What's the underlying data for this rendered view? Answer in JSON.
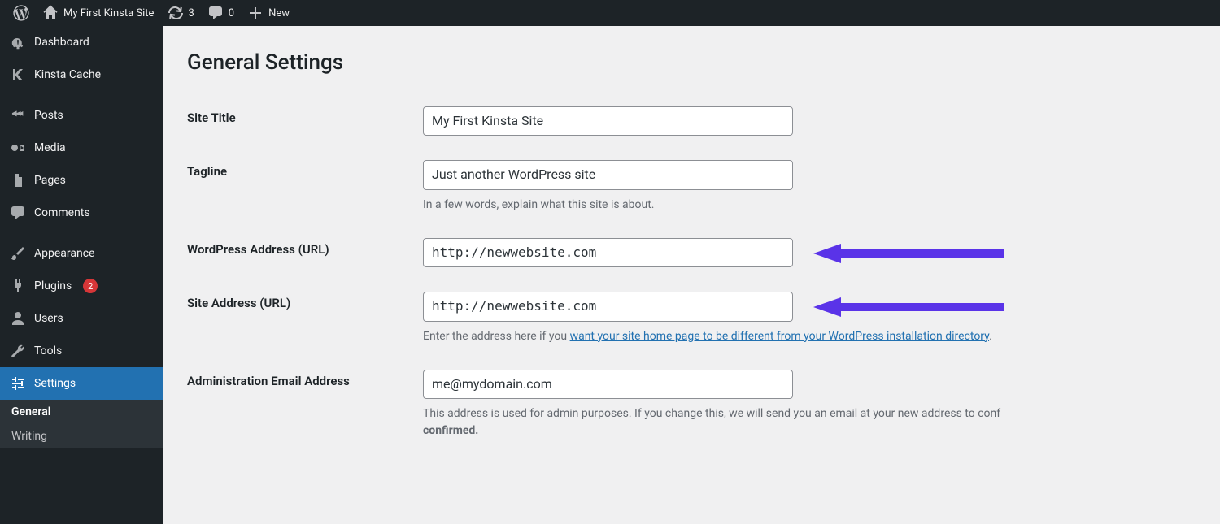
{
  "adminbar": {
    "site_name": "My First Kinsta Site",
    "updates_count": "3",
    "comments_count": "0",
    "new_label": "New"
  },
  "sidebar": {
    "dashboard": "Dashboard",
    "kinsta_cache": "Kinsta Cache",
    "posts": "Posts",
    "media": "Media",
    "pages": "Pages",
    "comments": "Comments",
    "appearance": "Appearance",
    "plugins": "Plugins",
    "plugins_count": "2",
    "users": "Users",
    "tools": "Tools",
    "settings": "Settings",
    "submenu": {
      "general": "General",
      "writing": "Writing"
    }
  },
  "page": {
    "title": "General Settings"
  },
  "fields": {
    "site_title": {
      "label": "Site Title",
      "value": "My First Kinsta Site"
    },
    "tagline": {
      "label": "Tagline",
      "value": "Just another WordPress site",
      "desc": "In a few words, explain what this site is about."
    },
    "wpurl": {
      "label": "WordPress Address (URL)",
      "value": "http://newwebsite.com"
    },
    "siteurl": {
      "label": "Site Address (URL)",
      "value": "http://newwebsite.com",
      "desc_prefix": "Enter the address here if you ",
      "desc_link": "want your site home page to be different from your WordPress installation directory",
      "desc_suffix": "."
    },
    "admin_email": {
      "label": "Administration Email Address",
      "value": "me@mydomain.com",
      "desc_prefix": "This address is used for admin purposes. If you change this, we will send you an email at your new address to conf",
      "desc_strong": "confirmed."
    }
  }
}
